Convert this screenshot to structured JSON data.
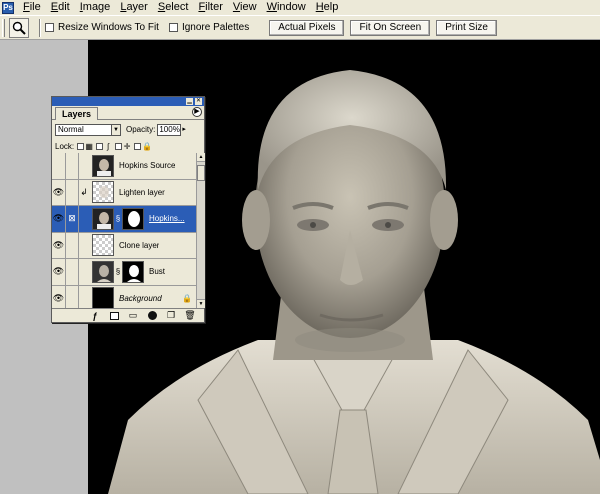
{
  "menubar": {
    "items": [
      {
        "label": "File",
        "u": "F",
        "rest": "ile"
      },
      {
        "label": "Edit",
        "u": "E",
        "rest": "dit"
      },
      {
        "label": "Image",
        "u": "I",
        "rest": "mage"
      },
      {
        "label": "Layer",
        "u": "L",
        "rest": "ayer"
      },
      {
        "label": "Select",
        "u": "S",
        "rest": "elect"
      },
      {
        "label": "Filter",
        "u": "F",
        "rest": "ilter"
      },
      {
        "label": "View",
        "u": "V",
        "rest": "iew"
      },
      {
        "label": "Window",
        "u": "W",
        "rest": "indow"
      },
      {
        "label": "Help",
        "u": "H",
        "rest": "elp"
      }
    ]
  },
  "options": {
    "resize_windows_label": "Resize Windows To Fit",
    "ignore_palettes_label": "Ignore Palettes",
    "actual_pixels_label": "Actual Pixels",
    "fit_on_screen_label": "Fit On Screen",
    "print_size_label": "Print Size",
    "tool_icon": "zoom-magnifier-icon"
  },
  "layers_panel": {
    "tab_label": "Layers",
    "blend_mode": "Normal",
    "opacity_label": "Opacity:",
    "opacity_value": "100%",
    "lock_label": "Lock:",
    "selected_color": "#2b5db6",
    "layers": [
      {
        "name": "Hopkins Source",
        "visible": false,
        "thumb": "portrait"
      },
      {
        "name": "Lighten layer",
        "visible": true,
        "thumb": "checker-portrait"
      },
      {
        "name": "Hopkins...",
        "visible": true,
        "thumb": "portrait",
        "has_mask": true,
        "selected": true
      },
      {
        "name": "Clone layer",
        "visible": true,
        "thumb": "checker"
      },
      {
        "name": "Bust",
        "visible": true,
        "thumb": "bust",
        "has_mask": true
      },
      {
        "name": "Background",
        "visible": true,
        "thumb": "black",
        "locked": true
      }
    ]
  }
}
